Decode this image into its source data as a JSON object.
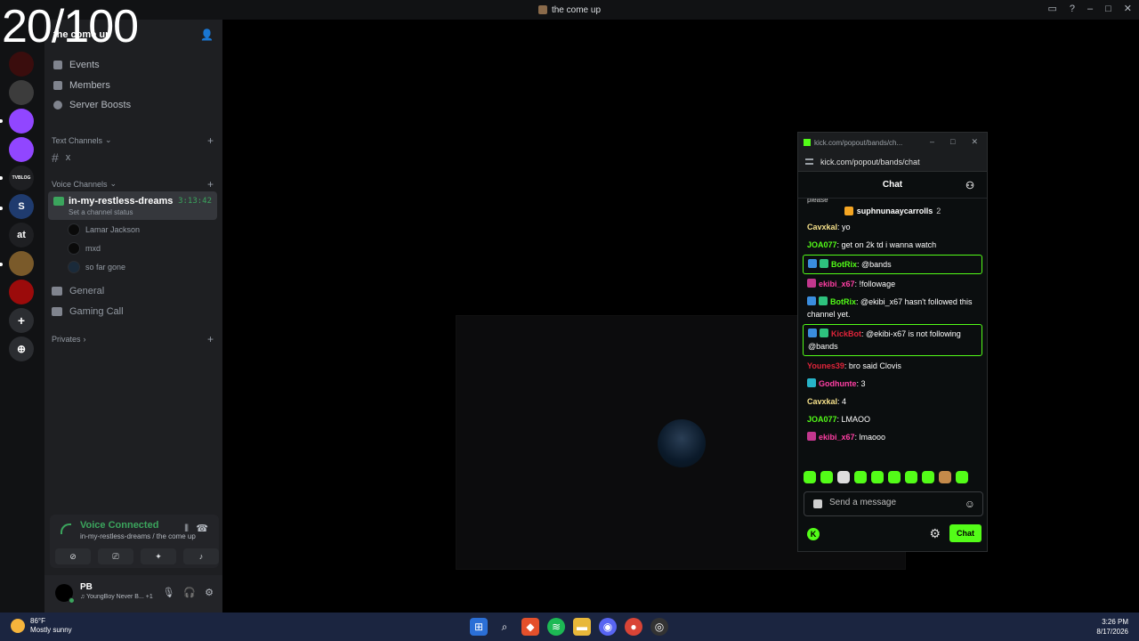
{
  "overlay_counter": "20/100",
  "window": {
    "title": "the come up"
  },
  "server_rail": {
    "items": [
      {
        "name": "server-1",
        "color": "#3a0d0d"
      },
      {
        "name": "server-2",
        "color": "#3c3c3c"
      },
      {
        "name": "twitch",
        "color": "#9146ff"
      },
      {
        "name": "twitch-big",
        "color": "#9146ff"
      },
      {
        "name": "tvblog",
        "color": "#1e1f22",
        "label": "TVBLOG"
      },
      {
        "name": "s-server",
        "color": "#1f3b6e",
        "label": "S"
      },
      {
        "name": "at-server",
        "color": "#1e1f22",
        "label": "at"
      },
      {
        "name": "game-server",
        "color": "#7a5a2a"
      },
      {
        "name": "red-server",
        "color": "#9b0b0b"
      }
    ]
  },
  "sidebar": {
    "server_name": "the come up",
    "menu": [
      "Events",
      "Members",
      "Server Boosts"
    ],
    "text_category": "Text Channels",
    "text_channels": [
      "x"
    ],
    "voice_category": "Voice Channels",
    "active_voice": {
      "name": "in-my-restless-dreams",
      "status": "Set a channel status",
      "timer": "3:13:42",
      "members": [
        "Lamar Jackson",
        "mxd",
        "so far gone"
      ]
    },
    "voice_channels": [
      "General",
      "Gaming Call"
    ],
    "privates": "Privates"
  },
  "voice_panel": {
    "title": "Voice Connected",
    "subtitle": "in-my-restless-dreams / the come up"
  },
  "user": {
    "name": "PB",
    "activity": "YoungBoy Never B...",
    "extra": "+1"
  },
  "kick": {
    "tab_title": "kick.com/popout/bands/ch...",
    "url": "kick.com/popout/bands/chat",
    "header": "Chat",
    "partial_line": "please",
    "pinned_user": "suphnunaaycarrolls",
    "pinned_count": "2",
    "messages": [
      {
        "user": "Cavxkal",
        "color": "#f5e08a",
        "text": "yo"
      },
      {
        "user": "JOA077",
        "color": "#53fc18",
        "text": "get on 2k td i wanna watch"
      },
      {
        "user": "BotRix",
        "color": "#53fc18",
        "text": "@bands",
        "highlight": true,
        "badges": [
          "#3a8dde",
          "#2ec27e"
        ]
      },
      {
        "user": "ekibi_x67",
        "color": "#ff3fa4",
        "text": "!followage",
        "badges": [
          "#c2378d"
        ]
      },
      {
        "user": "BotRix",
        "color": "#53fc18",
        "text": "@ekibi_x67 hasn't followed this channel yet.",
        "badges": [
          "#3a8dde",
          "#2ec27e"
        ]
      },
      {
        "user": "KickBot",
        "color": "#e0243a",
        "text": "@ekibi-x67 is not following @bands",
        "highlight": true,
        "badges": [
          "#3a8dde",
          "#2ec27e"
        ]
      },
      {
        "user": "Younes39",
        "color": "#e0243a",
        "text": "bro said Clovis"
      },
      {
        "user": "Godhunte",
        "color": "#ff3fa4",
        "text": "3",
        "badges": [
          "#27b3c8"
        ]
      },
      {
        "user": "Cavxkal",
        "color": "#f5e08a",
        "text": "4"
      },
      {
        "user": "JOA077",
        "color": "#53fc18",
        "text": "LMAOO"
      },
      {
        "user": "ekibi_x67",
        "color": "#ff3fa4",
        "text": "lmaooo",
        "badges": [
          "#c2378d"
        ]
      }
    ],
    "input_placeholder": "Send a message",
    "send_label": "Chat"
  },
  "taskbar": {
    "weather_temp": "86°F",
    "weather_desc": "Mostly sunny",
    "time": "3:26 PM",
    "date": "8/17/2026"
  }
}
